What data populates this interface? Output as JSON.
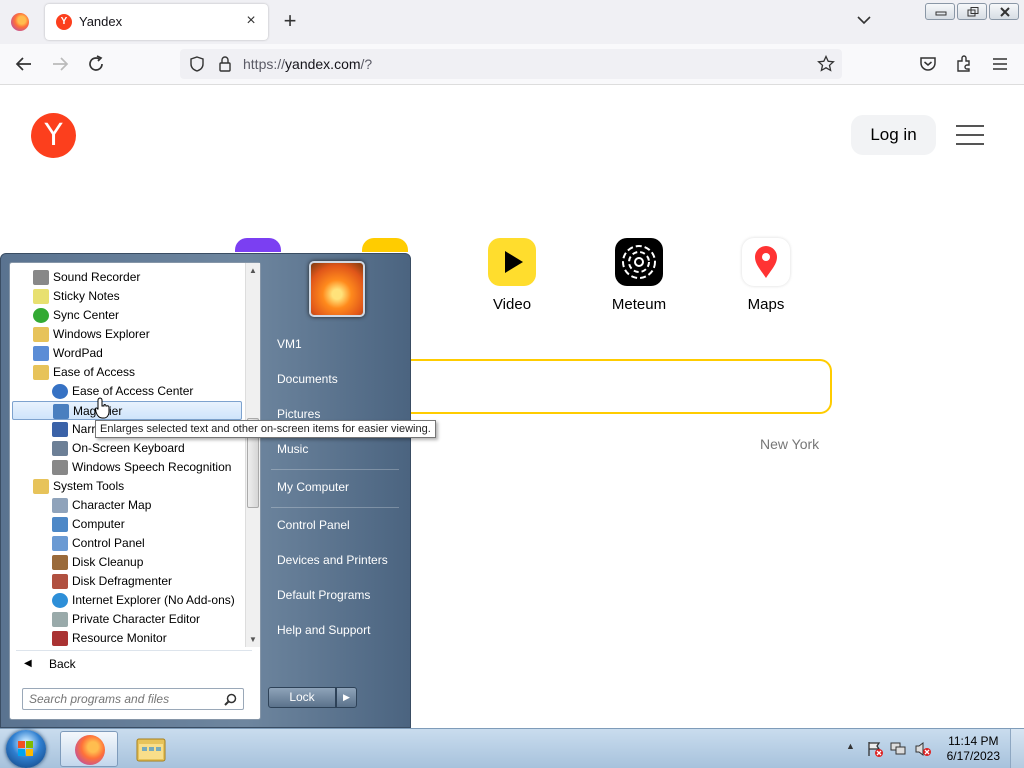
{
  "browser": {
    "tab_title": "Yandex",
    "tab_close": "×",
    "new_tab": "+",
    "url_prefix": "https://",
    "url_host": "yandex.com",
    "url_rest": "/?"
  },
  "page": {
    "logo_letter": "Y",
    "login_label": "Log in",
    "services": [
      {
        "label": "Video",
        "color": "#ffdd2d"
      },
      {
        "label": "Meteum",
        "color": "#000000"
      },
      {
        "label": "Maps",
        "color": "#ffffff"
      }
    ],
    "city": "New York"
  },
  "start_menu": {
    "programs": [
      {
        "label": "Sound Recorder",
        "icon": "microphone-icon",
        "indent": 0
      },
      {
        "label": "Sticky Notes",
        "icon": "sticky-notes-icon",
        "indent": 0
      },
      {
        "label": "Sync Center",
        "icon": "sync-icon",
        "indent": 0
      },
      {
        "label": "Windows Explorer",
        "icon": "folder-icon",
        "indent": 0
      },
      {
        "label": "WordPad",
        "icon": "wordpad-icon",
        "indent": 0
      },
      {
        "label": "Ease of Access",
        "icon": "folder-icon",
        "indent": 0
      },
      {
        "label": "Ease of Access Center",
        "icon": "ease-of-access-icon",
        "indent": 1
      },
      {
        "label": "Magnifier",
        "icon": "magnifier-icon",
        "indent": 1
      },
      {
        "label": "Narrator",
        "icon": "narrator-icon",
        "indent": 1
      },
      {
        "label": "On-Screen Keyboard",
        "icon": "keyboard-icon",
        "indent": 1
      },
      {
        "label": "Windows Speech Recognition",
        "icon": "microphone-icon",
        "indent": 1
      },
      {
        "label": "System Tools",
        "icon": "folder-icon",
        "indent": 0
      },
      {
        "label": "Character Map",
        "icon": "character-map-icon",
        "indent": 1
      },
      {
        "label": "Computer",
        "icon": "computer-icon",
        "indent": 1
      },
      {
        "label": "Control Panel",
        "icon": "control-panel-icon",
        "indent": 1
      },
      {
        "label": "Disk Cleanup",
        "icon": "disk-cleanup-icon",
        "indent": 1
      },
      {
        "label": "Disk Defragmenter",
        "icon": "defrag-icon",
        "indent": 1
      },
      {
        "label": "Internet Explorer (No Add-ons)",
        "icon": "internet-explorer-icon",
        "indent": 1
      },
      {
        "label": "Private Character Editor",
        "icon": "character-editor-icon",
        "indent": 1
      },
      {
        "label": "Resource Monitor",
        "icon": "resource-monitor-icon",
        "indent": 1
      }
    ],
    "selected": "Magnifier",
    "back_label": "Back",
    "search_placeholder": "Search programs and files",
    "right_items": [
      "VM1",
      "Documents",
      "Pictures",
      "Music",
      "My Computer",
      "Control Panel",
      "Devices and Printers",
      "Default Programs",
      "Help and Support"
    ],
    "lock_label": "Lock",
    "tooltip": "Enlarges selected text and other on-screen items for easier viewing."
  },
  "taskbar": {
    "time": "11:14 PM",
    "date": "6/17/2023"
  }
}
